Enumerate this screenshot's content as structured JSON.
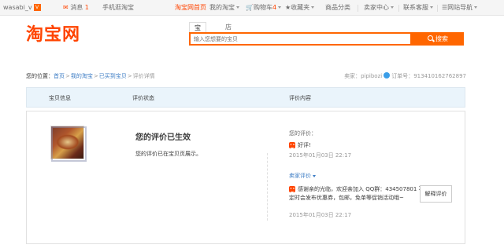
{
  "topbar": {
    "username": "wasabi_v",
    "vip_badge": "V",
    "messages_label": "消息",
    "messages_count": "1",
    "mobile_taobao": "手机逛淘宝",
    "taobao_home": "淘宝网首页",
    "my_taobao": "我的淘宝",
    "cart_label": "购物车",
    "cart_count": "4",
    "favorites": "收藏夹",
    "categories": "商品分类",
    "seller_center": "卖家中心",
    "contact_service": "联系客服",
    "site_nav": "网站导航"
  },
  "header": {
    "logo": "淘宝网",
    "tab_item": "宝贝",
    "tab_shop": "店铺",
    "search_placeholder": "输入您想要的宝贝",
    "search_button": "搜索"
  },
  "breadcrumb": {
    "prefix": "您的位置：",
    "home": "首页",
    "my_taobao": "我的淘宝",
    "bought": "已买到宝贝",
    "current": "评价详情"
  },
  "seller": {
    "label": "卖家：",
    "name": "pipibozi",
    "order_label": "订单号：",
    "order_no": "913410162762897"
  },
  "table_header": {
    "col1": "宝贝信息",
    "col2": "评价状态",
    "col3": "评价内容"
  },
  "review": {
    "effect_title": "您的评价已生效",
    "effect_desc": "您的评价已在宝贝页展示。",
    "my_label": "您的评价：",
    "my_rating": "好评!",
    "my_time": "2015年01月03日 22:17",
    "seller_label": "卖家评价",
    "seller_reply": "感谢亲的光临，欢迎亲加入 QQ群：434507801 不定时会发布优惠券，包邮，免单等促销活动哦~",
    "seller_time": "2015年01月03日 22:17",
    "explain_button": "解释评价"
  },
  "colors": {
    "brand": "#ff4400",
    "search_orange": "#ff6600",
    "link_blue": "#3c7cc4"
  }
}
